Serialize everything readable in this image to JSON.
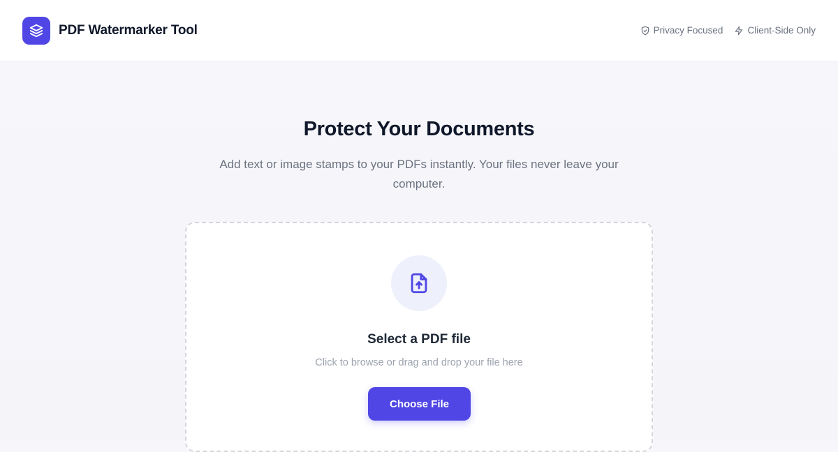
{
  "header": {
    "app_title": "PDF Watermarker Tool",
    "logo_icon": "layers-icon",
    "badges": [
      {
        "icon": "shield-icon",
        "label": "Privacy Focused"
      },
      {
        "icon": "lightning-icon",
        "label": "Client-Side Only"
      }
    ]
  },
  "hero": {
    "title": "Protect Your Documents",
    "subtitle": "Add text or image stamps to your PDFs instantly. Your files never leave your computer."
  },
  "dropzone": {
    "icon": "file-upload-icon",
    "title": "Select a PDF file",
    "hint": "Click to browse or drag and drop your file here",
    "button_label": "Choose File"
  },
  "colors": {
    "accent": "#4f46e5",
    "accent_light": "#eef0fb",
    "text_dark": "#0f172a",
    "text_muted": "#6b7280"
  }
}
